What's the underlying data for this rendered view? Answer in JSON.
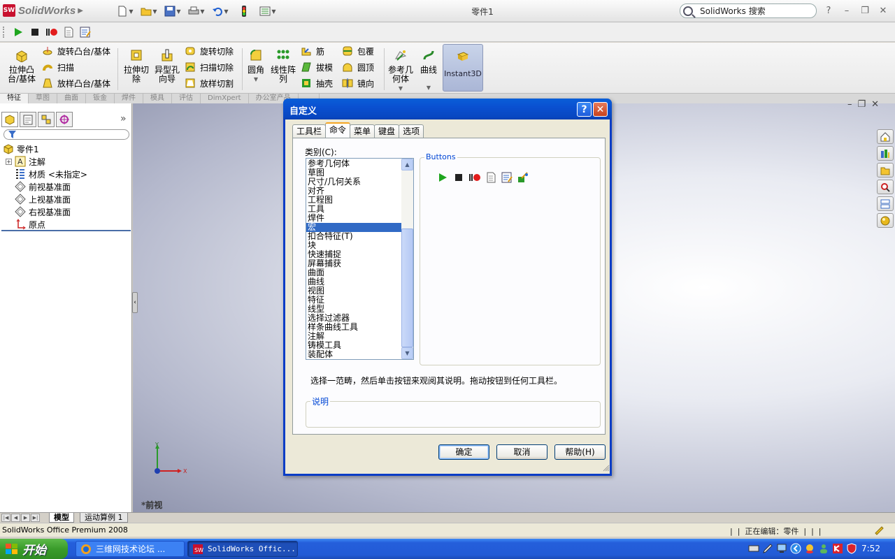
{
  "app": {
    "brand": "SolidWorks",
    "document_title": "零件1",
    "search_placeholder": "SolidWorks 搜索",
    "help_label": "?",
    "accent": "#0a50d1",
    "brand_color": "#c8102e"
  },
  "quick_access": [
    "new-icon",
    "open-icon",
    "save-icon",
    "print-icon",
    "undo-icon",
    "rebuild-icon",
    "options-icon"
  ],
  "macro_toolbar": [
    "run-macro-icon",
    "stop-macro-icon",
    "record-macro-icon",
    "new-macro-icon",
    "edit-macro-icon"
  ],
  "ribbon": {
    "extrude_boss": "拉伸凸\n台/基体",
    "revolve_boss": "旋转凸台/基体",
    "sweep": "扫描",
    "loft": "放样凸台/基体",
    "extrude_cut": "拉伸切\n除",
    "hole_wizard": "异型孔\n向导",
    "revolve_cut": "旋转切除",
    "swept_cut": "扫描切除",
    "lofted_cut": "放样切割",
    "fillet": "圆角",
    "linear_pattern": "线性阵\n列",
    "rib": "筋",
    "draft": "拔模",
    "shell": "抽壳",
    "wrap": "包覆",
    "dome": "圆顶",
    "mirror": "镜向",
    "ref_geometry": "参考几\n何体",
    "curves": "曲线",
    "instant3d": "Instant3D"
  },
  "command_tabs": [
    "特征",
    "草图",
    "曲面",
    "钣金",
    "焊件",
    "模具",
    "评估",
    "DimXpert",
    "办公室产品",
    "..."
  ],
  "feature_tree": {
    "root": "零件1",
    "items": [
      {
        "label": "注解",
        "icon": "annotation-icon",
        "expandable": true
      },
      {
        "label": "材质 <未指定>",
        "icon": "material-icon",
        "expandable": false
      },
      {
        "label": "前视基准面",
        "icon": "plane-icon",
        "expandable": false
      },
      {
        "label": "上视基准面",
        "icon": "plane-icon",
        "expandable": false
      },
      {
        "label": "右视基准面",
        "icon": "plane-icon",
        "expandable": false
      },
      {
        "label": "原点",
        "icon": "origin-icon",
        "expandable": false
      }
    ]
  },
  "graphics": {
    "view_label": "*前视",
    "triad": {
      "x": "X",
      "y": "Y"
    }
  },
  "bottom_tabs": {
    "model": "模型",
    "motion": "运动算例 1"
  },
  "status": {
    "left": "SolidWorks Office Premium 2008",
    "right": "|  |  正在编辑：零件  |  |  |"
  },
  "taskbar": {
    "start": "开始",
    "items": [
      "三维网技术论坛 ...",
      "SolidWorks Offic..."
    ],
    "clock": "7:52"
  },
  "dialog": {
    "title": "自定义",
    "tabs": [
      "工具栏",
      "命令",
      "菜单",
      "键盘",
      "选项"
    ],
    "active_tab": 1,
    "category_label": "类别(C):",
    "categories": [
      "参考几何体",
      "草图",
      "尺寸/几何关系",
      "对齐",
      "工程图",
      "工具",
      "焊件",
      "宏",
      "扣合特征(T)",
      "块",
      "快速捕捉",
      "屏幕捕获",
      "曲面",
      "曲线",
      "视图",
      "特征",
      "线型",
      "选择过滤器",
      "样条曲线工具",
      "注解",
      "铸模工具",
      "装配体"
    ],
    "selected_category": 7,
    "buttons_legend": "Buttons",
    "button_icons": [
      "run-macro-icon",
      "stop-macro-icon",
      "record-macro-icon",
      "new-macro-icon",
      "edit-macro-icon",
      "customize-macro-icon"
    ],
    "instruction": "选择一范畴，然后单击按钮来观阅其说明。拖动按钮到任何工具栏。",
    "description_legend": "说明",
    "ok": "确定",
    "cancel": "取消",
    "help": "帮助(H)"
  }
}
